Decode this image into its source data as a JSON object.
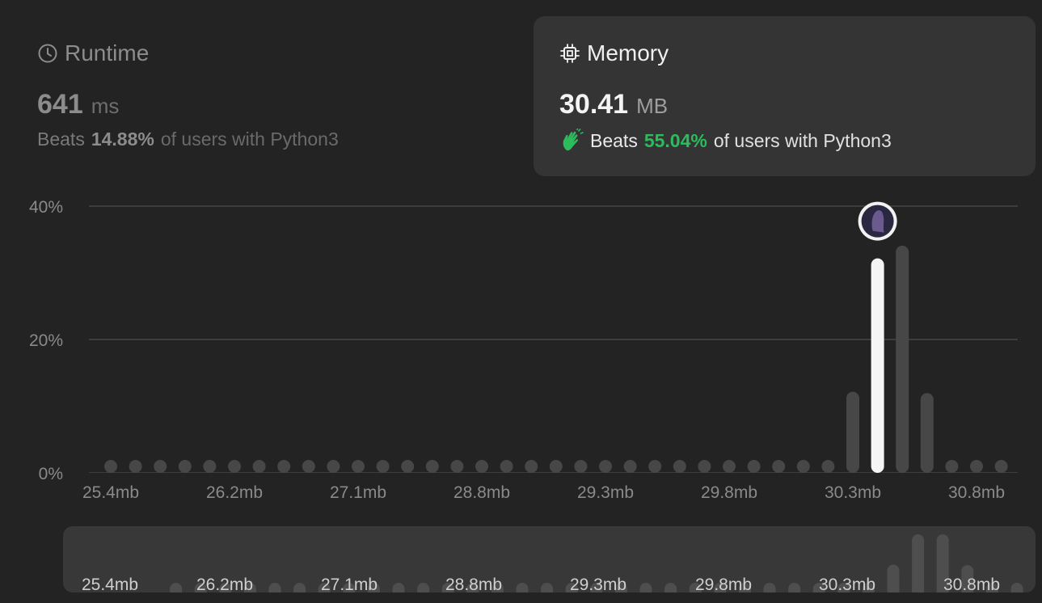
{
  "runtime": {
    "title": "Runtime",
    "value": "641",
    "unit": "ms",
    "beats_label": "Beats",
    "beats_pct": "14.88%",
    "beats_rest": "of users with Python3",
    "icon": "clock-icon"
  },
  "memory": {
    "title": "Memory",
    "value": "30.41",
    "unit": "MB",
    "beats_label": "Beats",
    "beats_pct": "55.04%",
    "beats_rest": "of users with Python3",
    "icon": "chip-icon",
    "beats_icon": "clap-icon",
    "accent": "#2cbb5d"
  },
  "chart_data": {
    "type": "bar",
    "title": "",
    "xlabel": "",
    "ylabel": "",
    "y_ticks": [
      "40%",
      "20%",
      "0%"
    ],
    "ylim": [
      0,
      40
    ],
    "grid": true,
    "x_tick_labels": [
      "25.4mb",
      "26.2mb",
      "27.1mb",
      "28.8mb",
      "29.3mb",
      "29.8mb",
      "30.3mb",
      "30.8mb"
    ],
    "values": [
      0.5,
      0.5,
      0.5,
      0.5,
      0.5,
      0.5,
      0.5,
      0.5,
      0.5,
      0.5,
      0.5,
      0.5,
      0.5,
      0.5,
      0.5,
      0.5,
      0.5,
      0.5,
      0.5,
      0.5,
      0.5,
      0.5,
      0.5,
      0.5,
      0.5,
      0.5,
      0.5,
      0.5,
      0.5,
      0.5,
      11.2,
      31.2,
      33.1,
      11.0,
      0.5,
      0.5,
      0.5
    ],
    "highlight_index": 31,
    "colors": {
      "bar": "#474747",
      "highlight": "#f5f5f5",
      "grid": "#464646",
      "tick": "#8a8a8a"
    }
  }
}
